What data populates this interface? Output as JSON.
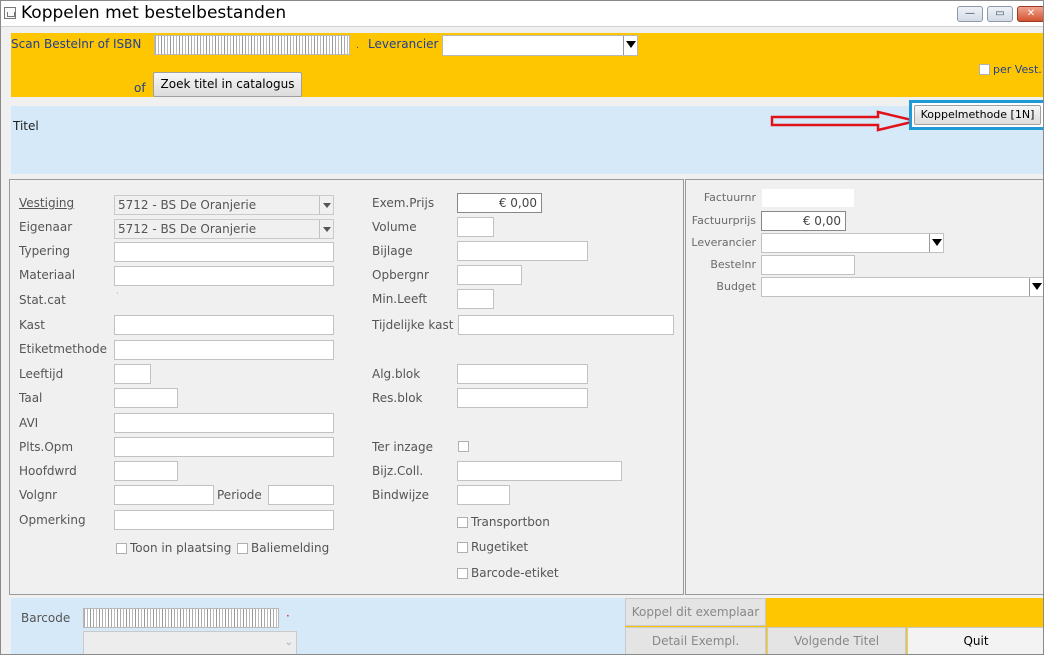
{
  "window": {
    "title": "Koppelen met bestelbestanden"
  },
  "header": {
    "scan_label": "Scan Bestelnr of ISBN",
    "leverancier_label": "Leverancier",
    "of_label": "of",
    "zoek_button": "Zoek titel in catalogus",
    "per_vest_label": "per Vest."
  },
  "title_bar": {
    "titel_label": "Titel",
    "koppelmethode_button": "Koppelmethode [1N]"
  },
  "left": {
    "vestiging_label": "Vestiging",
    "vestiging_value": "5712 - BS De Oranjerie",
    "eigenaar_label": "Eigenaar",
    "eigenaar_value": "5712 - BS De Oranjerie",
    "typering_label": "Typering",
    "materiaal_label": "Materiaal",
    "statcat_label": "Stat.cat",
    "kast_label": "Kast",
    "etiketmethode_label": "Etiketmethode",
    "leeftijd_label": "Leeftijd",
    "taal_label": "Taal",
    "avi_label": "AVI",
    "pltsopm_label": "Plts.Opm",
    "hoofdwrd_label": "Hoofdwrd",
    "volgnr_label": "Volgnr",
    "periode_label": "Periode",
    "opmerking_label": "Opmerking",
    "toon_label": "Toon in plaatsing",
    "baliemelding_label": "Baliemelding"
  },
  "middle": {
    "exemprijs_label": "Exem.Prijs",
    "exemprijs_value": "€ 0,00",
    "volume_label": "Volume",
    "bijlage_label": "Bijlage",
    "opbergnr_label": "Opbergnr",
    "minleeft_label": "Min.Leeft",
    "tijdelijke_label": "Tijdelijke kast",
    "algblok_label": "Alg.blok",
    "resblok_label": "Res.blok",
    "terinzage_label": "Ter inzage",
    "bijzcoll_label": "Bijz.Coll.",
    "bindwijze_label": "Bindwijze",
    "transportbon_label": "Transportbon",
    "rugetiket_label": "Rugetiket",
    "barcodeetiket_label": "Barcode-etiket"
  },
  "right": {
    "factuurnr_label": "Factuurnr",
    "factuurprijs_label": "Factuurprijs",
    "factuurprijs_value": "€ 0,00",
    "leverancier_label": "Leverancier",
    "bestelnr_label": "Bestelnr",
    "budget_label": "Budget"
  },
  "footer": {
    "barcode_label": "Barcode",
    "koppel_button": "Koppel dit exemplaar",
    "detail_button": "Detail Exempl.",
    "volgende_button": "Volgende Titel",
    "quit_button": "Quit"
  },
  "colors": {
    "accent_yellow": "#fec600",
    "light_blue": "#d6e9f8",
    "highlight_blue": "#1e9bd7",
    "arrow_red": "#e0121a"
  }
}
